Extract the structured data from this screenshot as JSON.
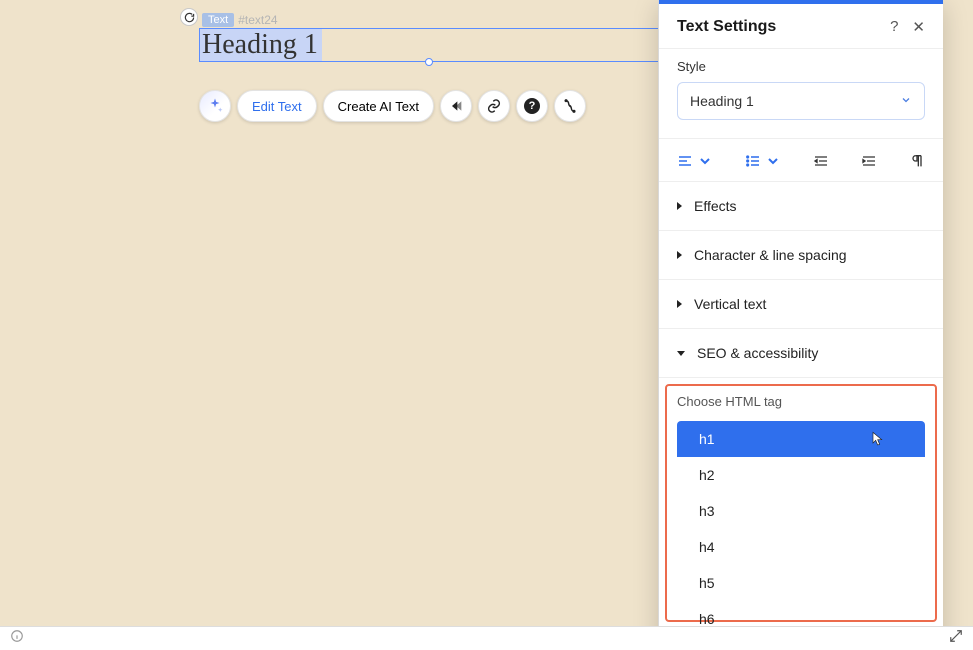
{
  "canvas": {
    "element_type_badge": "Text",
    "element_id_badge": "#text24",
    "heading_text": "Heading 1"
  },
  "toolbar": {
    "edit_text": "Edit Text",
    "create_ai_text": "Create AI Text"
  },
  "panel": {
    "title": "Text Settings",
    "style_label": "Style",
    "style_value": "Heading 1",
    "accordions": {
      "effects": "Effects",
      "char_line": "Character & line spacing",
      "vertical": "Vertical text",
      "seo": "SEO & accessibility"
    },
    "seo": {
      "label": "Choose HTML tag",
      "options": [
        "h1",
        "h2",
        "h3",
        "h4",
        "h5",
        "h6"
      ],
      "selected": "h1"
    }
  }
}
